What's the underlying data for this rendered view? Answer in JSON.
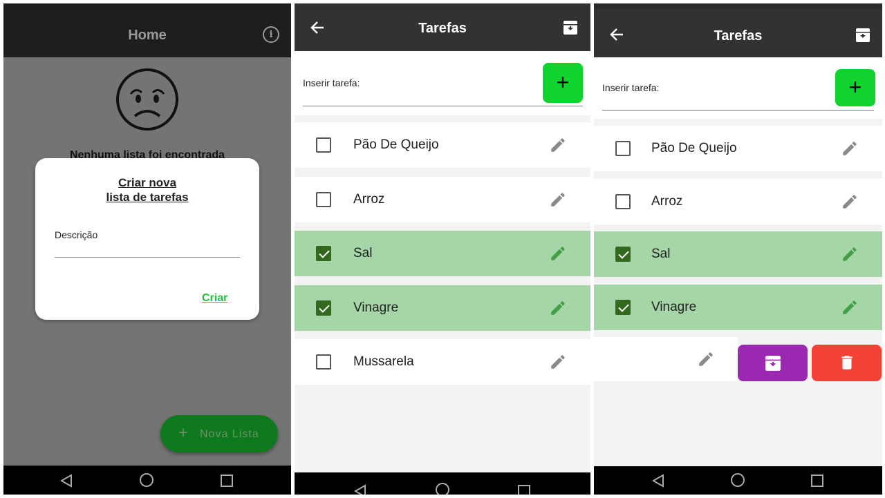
{
  "colors": {
    "accent_green": "#10d32e",
    "done_row": "#a5d6a7",
    "check_green": "#33691e",
    "archive_purple": "#9c27b0",
    "delete_red": "#f44336"
  },
  "screen_home": {
    "title": "Home",
    "info_icon": "info-icon",
    "empty_message": "Nenhuma lista foi encontrada",
    "dialog": {
      "title_line1": "Criar nova",
      "title_line2": "lista de tarefas",
      "field_label": "Descrição",
      "create_label": "Criar"
    },
    "fab_label": "Nova Lista"
  },
  "screen_tasks": {
    "title": "Tarefas",
    "input_label": "Inserir tarefa:",
    "tasks": [
      {
        "label": "Pão De Queijo",
        "done": false
      },
      {
        "label": "Arroz",
        "done": false
      },
      {
        "label": "Sal",
        "done": true
      },
      {
        "label": "Vinagre",
        "done": true
      },
      {
        "label": "Mussarela",
        "done": false
      }
    ]
  },
  "screen_swipe": {
    "title": "Tarefas",
    "input_label": "Inserir tarefa:",
    "tasks": [
      {
        "label": "Pão De Queijo",
        "done": false
      },
      {
        "label": "Arroz",
        "done": false
      },
      {
        "label": "Sal",
        "done": true
      },
      {
        "label": "Vinagre",
        "done": true
      }
    ],
    "swipe_actions": [
      "archive-icon",
      "delete-icon"
    ]
  }
}
